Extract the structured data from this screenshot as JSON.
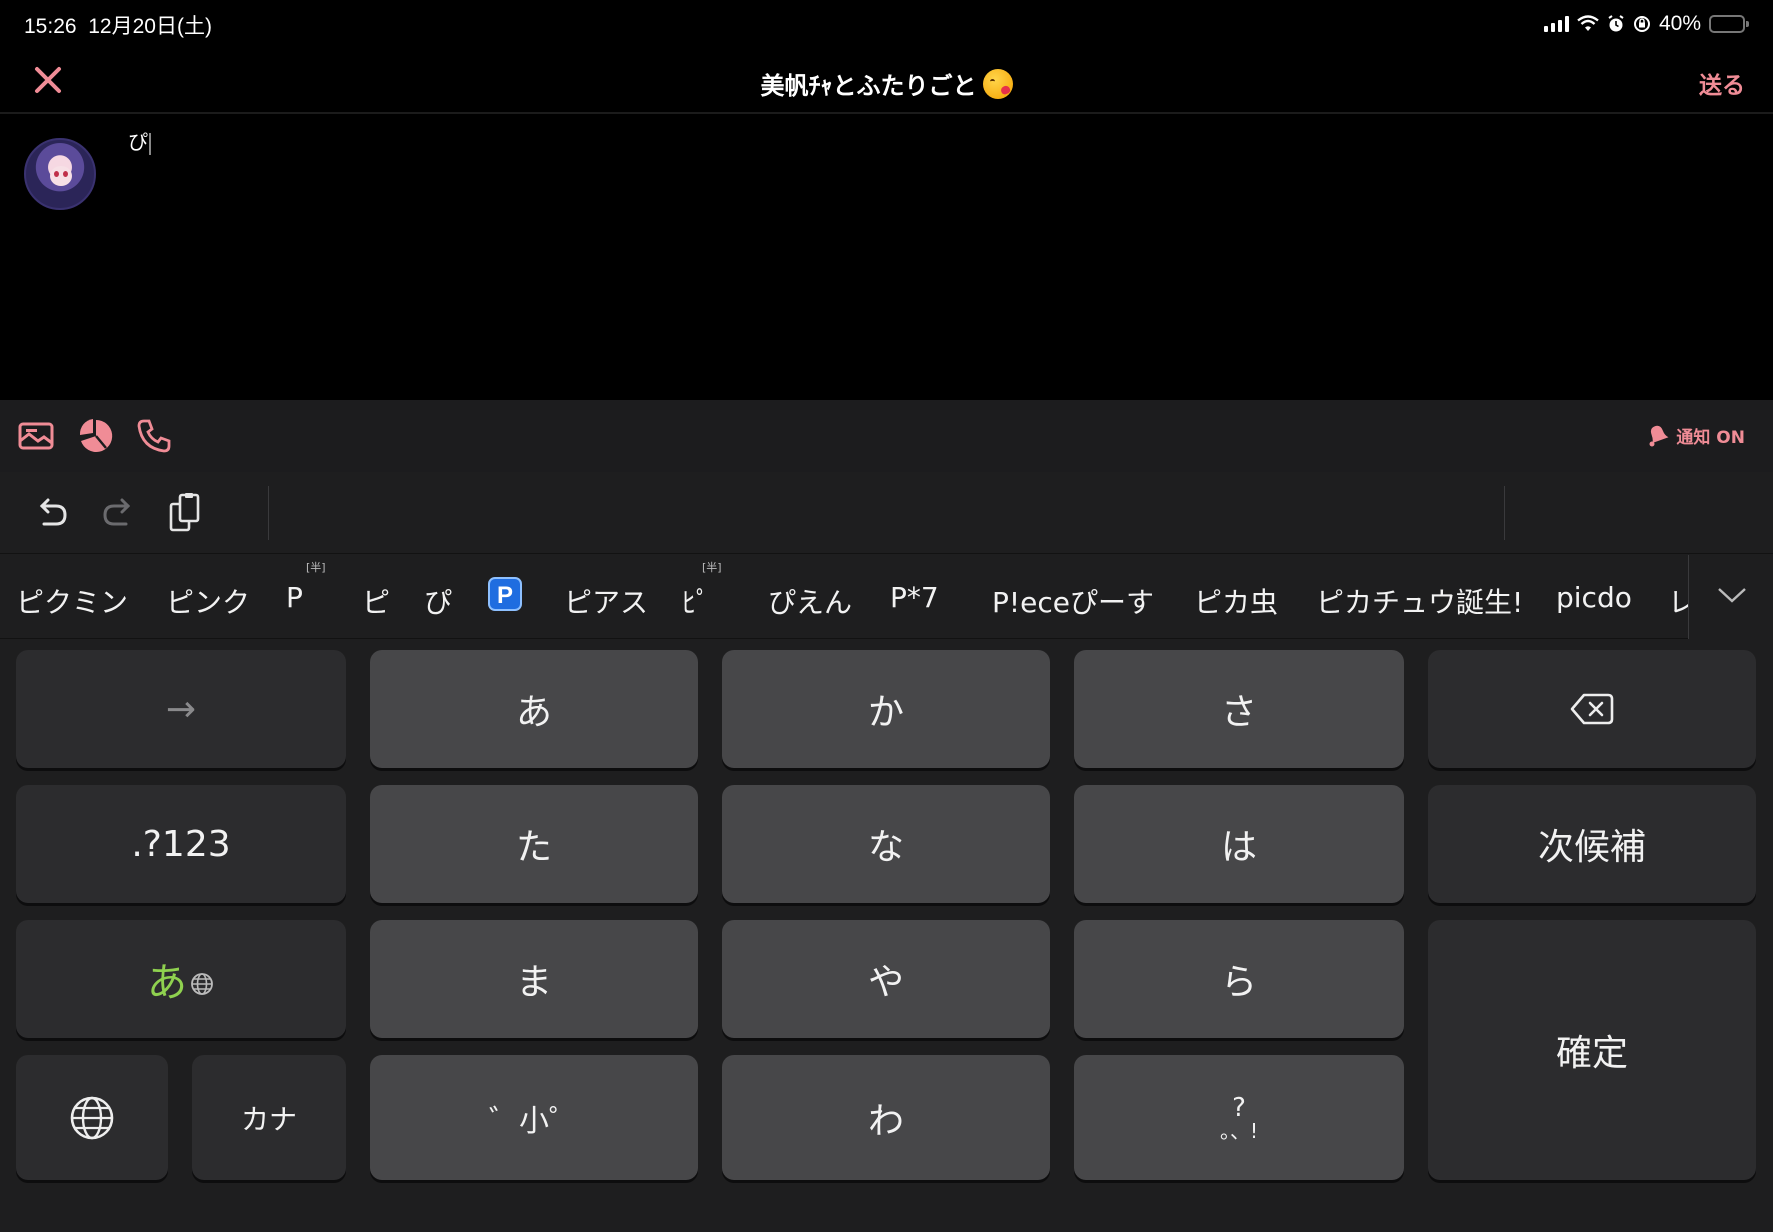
{
  "status_bar": {
    "time": "15:26",
    "date": "12月20日(土)",
    "battery_percent": "40%",
    "battery_level": 0.4,
    "icons": [
      "signal-icon",
      "wifi-icon",
      "alarm-icon",
      "orientation-lock-icon",
      "battery-icon"
    ]
  },
  "header": {
    "close_icon": "close-icon",
    "title": "美帆ﾁｬとふたりごと",
    "title_emoji": "kissing-face-emoji",
    "send_label": "送る"
  },
  "compose": {
    "text": "ぴ",
    "avatar": "avatar"
  },
  "action_bar": {
    "icons": [
      "image-icon",
      "pie-chart-icon",
      "phone-icon"
    ],
    "notify_label": "通知 ON"
  },
  "keyboard": {
    "toolbar": {
      "icons": [
        "undo-icon",
        "redo-icon",
        "clipboard-icon"
      ]
    },
    "candidates": [
      {
        "text": "ピクミン"
      },
      {
        "text": "ピンク"
      },
      {
        "text": "P",
        "sup": "[半]"
      },
      {
        "text": "ピ"
      },
      {
        "text": "ぴ"
      },
      {
        "text": "P",
        "badge": true
      },
      {
        "text": "ピアス"
      },
      {
        "text": "ﾋﾟ",
        "sup": "[半]"
      },
      {
        "text": "ぴえん"
      },
      {
        "text": "P*7"
      },
      {
        "text": "P!eceぴーす"
      },
      {
        "text": "ピカ虫"
      },
      {
        "text": "ピカチュウ誕生!"
      },
      {
        "text": "picdo"
      },
      {
        "text": "レ"
      }
    ],
    "keys": {
      "arrow": "→",
      "a": "あ",
      "ka": "か",
      "sa": "さ",
      "numbers": ".?123",
      "ta": "た",
      "na": "な",
      "ha": "は",
      "next_candidate": "次候補",
      "input_mode": "あ",
      "ma": "ま",
      "ya": "や",
      "ra": "ら",
      "confirm": "確定",
      "kana": "カナ",
      "dakuten": "゛小゜",
      "wa": "わ",
      "punct_top": "?",
      "punct_bottom": "。、!"
    },
    "colors": {
      "accent_pink": "#f08c96",
      "mode_green": "#8fd14f",
      "key_light": "#474749",
      "key_dark": "#2c2c2e"
    }
  }
}
